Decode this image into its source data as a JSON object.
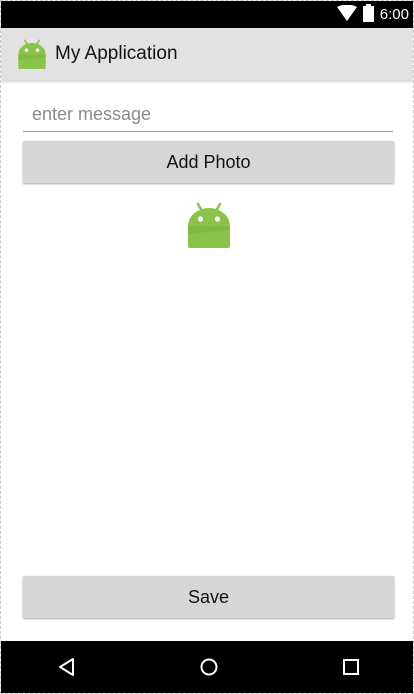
{
  "status_bar": {
    "time": "6:00",
    "icons": [
      "wifi-icon",
      "battery-icon"
    ]
  },
  "app_bar": {
    "title": "My Application",
    "logo_icon": "android-icon"
  },
  "message_input": {
    "value": "",
    "placeholder": "enter message"
  },
  "add_photo_button": {
    "label": "Add Photo"
  },
  "photo": {
    "icon": "android-icon"
  },
  "save_button": {
    "label": "Save"
  },
  "nav_bar": {
    "items": [
      "back-icon",
      "home-icon",
      "recent-apps-icon"
    ]
  },
  "colors": {
    "android_green": "#8bc34a",
    "app_bar": "#e2e2e2",
    "button": "#d6d6d6",
    "system_bar": "#000000"
  }
}
